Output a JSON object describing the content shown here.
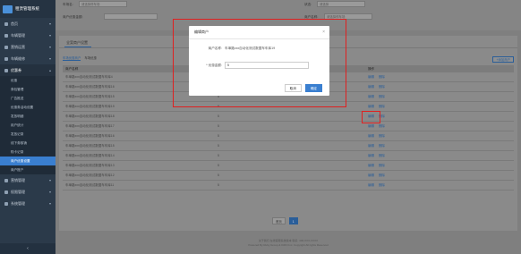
{
  "app": {
    "title": "租赁管理系统"
  },
  "sidebar": {
    "items": [
      {
        "label": "首页"
      },
      {
        "label": "车辆管理"
      },
      {
        "label": "营销运营"
      },
      {
        "label": "车辆维修"
      },
      {
        "label": "统计报表"
      }
    ],
    "open_section": "优惠券",
    "sub_items": [
      "优惠",
      "券包管理",
      "广告推送",
      "优惠券活动设置",
      "发放明细",
      "用户统计",
      "发放记录",
      "线下券核销",
      "购卡记录",
      "商户优惠设置",
      "商户账户"
    ],
    "bottom_items": [
      {
        "label": "营销管理"
      },
      {
        "label": "权限管理"
      },
      {
        "label": "系统管理"
      }
    ],
    "collapse_icon": "chevron-left-icon"
  },
  "filters": {
    "label_1": "车场名:",
    "label_2": "状态:",
    "label_3": "商户名称:",
    "label_4": "商户优惠金额:",
    "placeholder_1": "请选择停车场",
    "placeholder_2": "请选择",
    "placeholder_3": "",
    "placeholder_4": "请选择停车场",
    "search_label": "查询",
    "reset_label": "重置"
  },
  "panel": {
    "tab": "全案商户设置",
    "sub_tabs": [
      "车场优惠商户",
      "车场优惠"
    ],
    "add_button": "+添加商户",
    "columns": [
      "商户名称",
      "优惠金额",
      "操作"
    ],
    "rows": [
      {
        "name": "车埠路xxx自动化测试数据车车库4",
        "amount": "5"
      },
      {
        "name": "车埠路xxx自动化测试数据车车库16",
        "amount": "5"
      },
      {
        "name": "车埠路xxx自动化测试数据车车库15",
        "amount": "5"
      },
      {
        "name": "车埠路xxx自动化测试数据车车库19",
        "amount": "5"
      },
      {
        "name": "车埠路xxx自动化测试数据车车库18",
        "amount": "5"
      },
      {
        "name": "车埠路xxx自动化测试数据车车库17",
        "amount": "5"
      },
      {
        "name": "车埠路xxx自动化测试数据车车库16",
        "amount": "5"
      },
      {
        "name": "车埠路xxx自动化测试数据车车库15",
        "amount": "5"
      },
      {
        "name": "车埠路xxx自动化测试数据车车库14",
        "amount": "5"
      },
      {
        "name": "车埠路xxx自动化测试数据车车库13",
        "amount": "5"
      },
      {
        "name": "车埠路xxx自动化测试数据车车库12",
        "amount": "5"
      },
      {
        "name": "车埠路xxx自动化测试数据车车库11",
        "amount": "5"
      }
    ],
    "edit_label": "编辑",
    "delete_label": "删除"
  },
  "pager": {
    "prev": "首页",
    "current": "1"
  },
  "footer": {
    "line1": "关于我们    在线客服系统版本    联系: 400-XXX-XXXX",
    "line2": "Powered By Ruby Group & ICDN Inc. Copyright All rights Reserved"
  },
  "modal": {
    "title": "编辑商户",
    "name_label": "商户名称:",
    "name_value": "车埠路xxx自动化测试数据车车库19",
    "amount_label": "* 优惠金额:",
    "amount_value": "5",
    "cancel": "取消",
    "confirm": "确定"
  },
  "colors": {
    "highlight": "#e02020",
    "primary": "#3a7fd0",
    "sidebar": "#2b3a4a"
  }
}
